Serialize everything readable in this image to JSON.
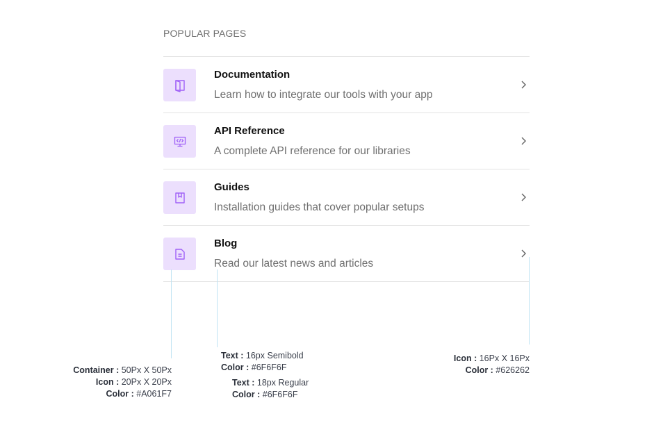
{
  "section": {
    "title": "POPULAR PAGES"
  },
  "items": [
    {
      "title": "Documentation",
      "description": "Learn how to integrate our tools with your app",
      "icon": "book-open-icon"
    },
    {
      "title": "API Reference",
      "description": "A complete API reference for our libraries",
      "icon": "code-monitor-icon"
    },
    {
      "title": "Guides",
      "description": "Installation guides that cover popular setups",
      "icon": "bookmark-book-icon"
    },
    {
      "title": "Blog",
      "description": "Read our latest news and articles",
      "icon": "document-icon"
    }
  ],
  "annotations": {
    "container": {
      "line1_label": "Container :",
      "line1_value": "50Px X 50Px",
      "line2_label": "Icon :",
      "line2_value": "20Px X 20Px",
      "line3_label": "Color :",
      "line3_value": "#A061F7"
    },
    "title_text": {
      "line1_label": "Text :",
      "line1_value": "16px Semibold",
      "line2_label": "Color :",
      "line2_value": "#6F6F6F"
    },
    "desc_text": {
      "line1_label": "Text :",
      "line1_value": "18px Regular",
      "line2_label": "Color :",
      "line2_value": "#6F6F6F"
    },
    "chevron": {
      "line1_label": "Icon :",
      "line1_value": "16Px X 16Px",
      "line2_label": "Color :",
      "line2_value": "#626262"
    }
  },
  "colors": {
    "accent": "#A061F7",
    "icon_bg": "#ECDFFD",
    "text_muted": "#6F6F6F",
    "chevron": "#626262",
    "divider": "#E2E2E2"
  }
}
